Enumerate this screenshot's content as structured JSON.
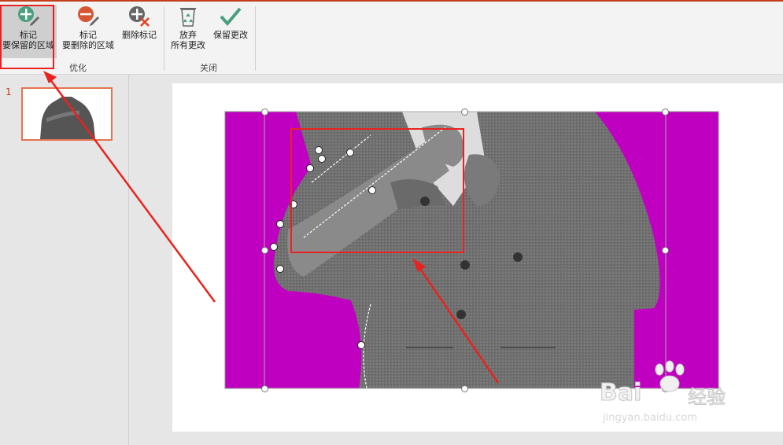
{
  "ribbon": {
    "mark_keep": {
      "line1": "标记",
      "line2": "要保留的区域"
    },
    "mark_remove": {
      "line1": "标记",
      "line2": "要删除的区域"
    },
    "delete_mark": {
      "label": "删除标记"
    },
    "discard": {
      "line1": "放弃",
      "line2": "所有更改"
    },
    "keep_changes": {
      "label": "保留更改"
    },
    "groups": {
      "refine": "优化",
      "close": "关闭"
    }
  },
  "slides": {
    "number": "1"
  },
  "watermark": {
    "brand": "Bai",
    "brand2": "经验",
    "url": "jingyan.baidu.com"
  },
  "colors": {
    "accent": "#c43e1c",
    "remove_area": "#c000c0",
    "annotation": "#e8231f"
  }
}
